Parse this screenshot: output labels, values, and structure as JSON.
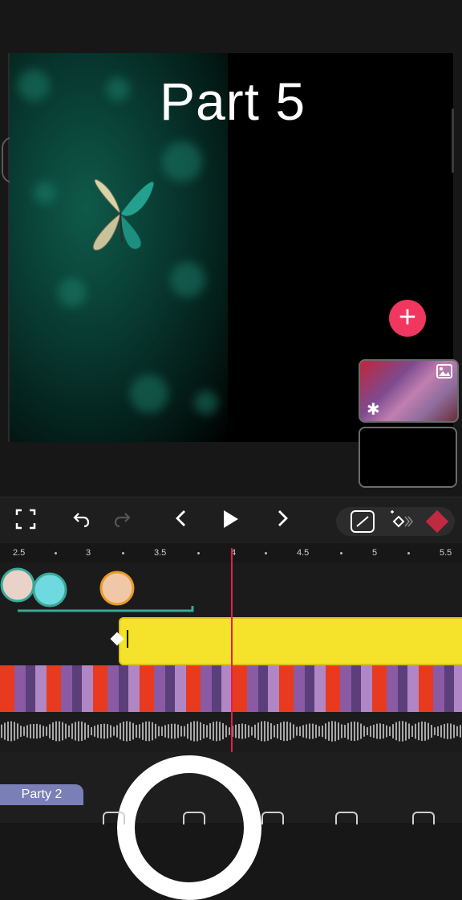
{
  "preview": {
    "title_text": "Part 5",
    "add_label": "+"
  },
  "toolbar": {
    "fullscreen_icon": "fullscreen-icon",
    "undo_icon": "undo-icon",
    "redo_icon": "redo-icon",
    "prev_icon": "chevron-left-icon",
    "play_icon": "play-icon",
    "next_icon": "chevron-right-icon",
    "keyframe_icons": [
      "line-tool-icon",
      "keyframe-add-icon",
      "keyframe-diamond-icon"
    ]
  },
  "ruler": {
    "ticks": [
      "2.5",
      "3",
      "3.5",
      "4",
      "4.5",
      "5",
      "5.5"
    ]
  },
  "timeline": {
    "layer_tab_label": "Party 2"
  },
  "colors": {
    "accent": "#f0375f",
    "playhead": "#e0204a",
    "text_clip": "#f5e22a",
    "layer_tab": "#7b7fb8"
  }
}
